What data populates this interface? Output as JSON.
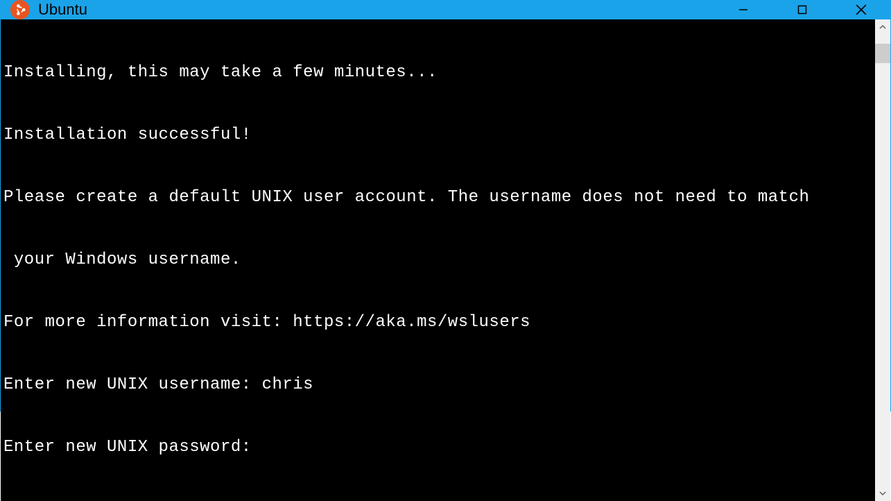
{
  "titlebar": {
    "app_name": "Ubuntu",
    "icon": "ubuntu-logo"
  },
  "window_controls": {
    "minimize": "minimize",
    "maximize": "maximize",
    "close": "close"
  },
  "terminal": {
    "lines": [
      "Installing, this may take a few minutes...",
      "Installation successful!",
      "Please create a default UNIX user account. The username does not need to match",
      " your Windows username.",
      "For more information visit: https://aka.ms/wslusers"
    ],
    "username_prompt": "Enter new UNIX username: ",
    "username_value": "chris",
    "password_prompt": "Enter new UNIX password:",
    "password_value": ""
  },
  "colors": {
    "titlebar_bg": "#1aa3e8",
    "terminal_bg": "#000000",
    "terminal_fg": "#ffffff",
    "ubuntu_orange": "#e95420"
  }
}
